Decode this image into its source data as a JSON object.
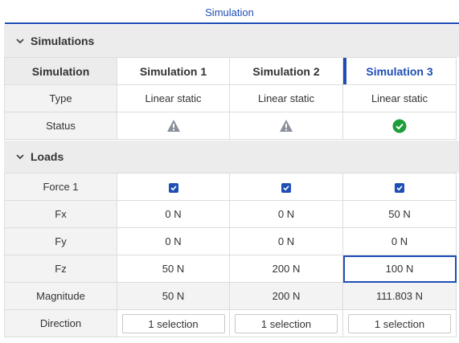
{
  "header": {
    "title": "Simulation"
  },
  "sections": {
    "simulations": "Simulations",
    "loads": "Loads"
  },
  "columns": {
    "label": "Simulation",
    "sims": [
      "Simulation 1",
      "Simulation 2",
      "Simulation 3"
    ]
  },
  "sim_rows": {
    "type": {
      "label": "Type",
      "values": [
        "Linear static",
        "Linear static",
        "Linear static"
      ]
    },
    "status": {
      "label": "Status",
      "values": [
        "warning-icon",
        "warning-icon",
        "success-icon"
      ]
    }
  },
  "load_rows": {
    "force1": {
      "label": "Force 1",
      "values": [
        true,
        true,
        true
      ]
    },
    "fx": {
      "label": "Fx",
      "values": [
        "0 N",
        "0 N",
        "50 N"
      ]
    },
    "fy": {
      "label": "Fy",
      "values": [
        "0 N",
        "0 N",
        "0 N"
      ]
    },
    "fz": {
      "label": "Fz",
      "values": [
        "50 N",
        "200 N",
        "100 N"
      ]
    },
    "magnitude": {
      "label": "Magnitude",
      "values": [
        "50 N",
        "200 N",
        "111.803 N"
      ]
    },
    "direction": {
      "label": "Direction",
      "values": [
        "1 selection",
        "1 selection",
        "1 selection"
      ]
    }
  },
  "colors": {
    "accent": "#1f4fb5",
    "warning": "#8a8f99",
    "success": "#1e9e3a"
  }
}
